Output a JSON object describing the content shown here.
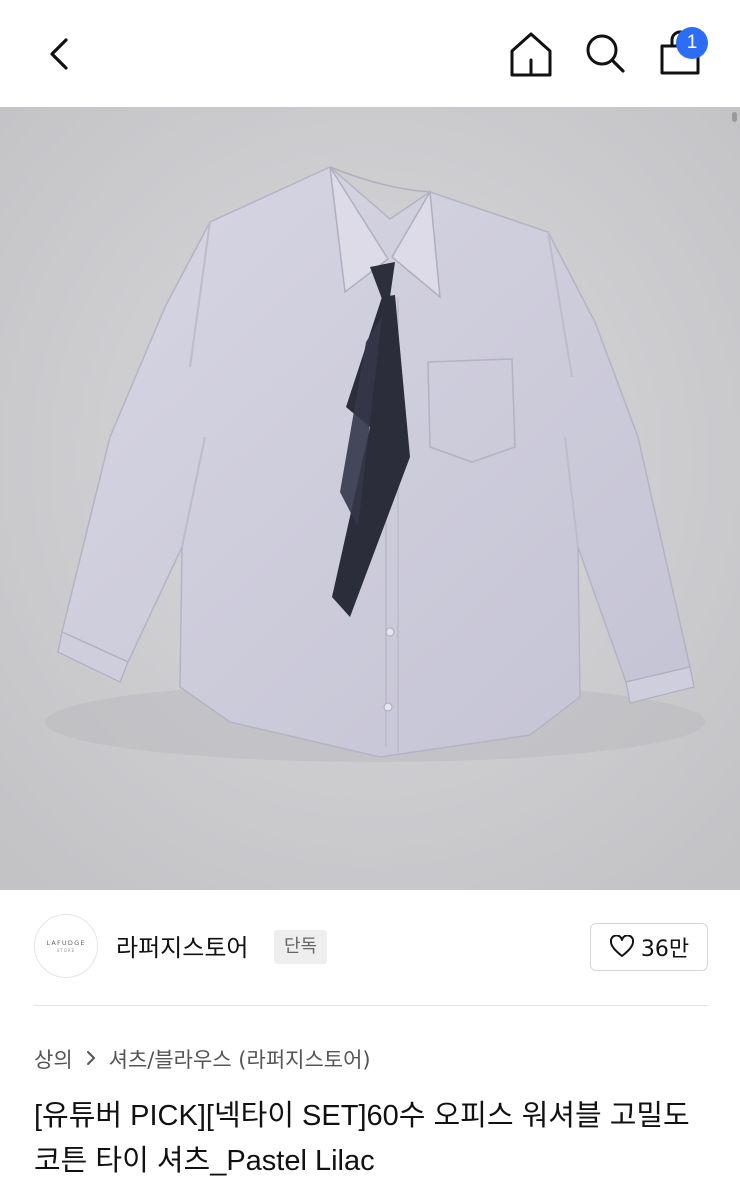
{
  "header": {
    "back_icon": "chevron-left-icon",
    "home_icon": "home-icon",
    "search_icon": "search-icon",
    "cart_icon": "shopping-bag-icon",
    "cart_count": "1",
    "badge_color": "#2d6df6"
  },
  "store": {
    "logo_text": "LAFUDGE",
    "logo_subtext": "STORE",
    "name": "라퍼지스토어",
    "tag": "단독",
    "like_icon": "heart-outline-icon",
    "like_count": "36만"
  },
  "breadcrumb": {
    "category": "상의",
    "subcategory": "셔츠/블라우스 (라퍼지스토어)"
  },
  "product": {
    "title": "[유튜버 PICK][넥타이 SET]60수 오피스 워셔블 고밀도 코튼 타이 셔츠_Pastel Lilac"
  }
}
